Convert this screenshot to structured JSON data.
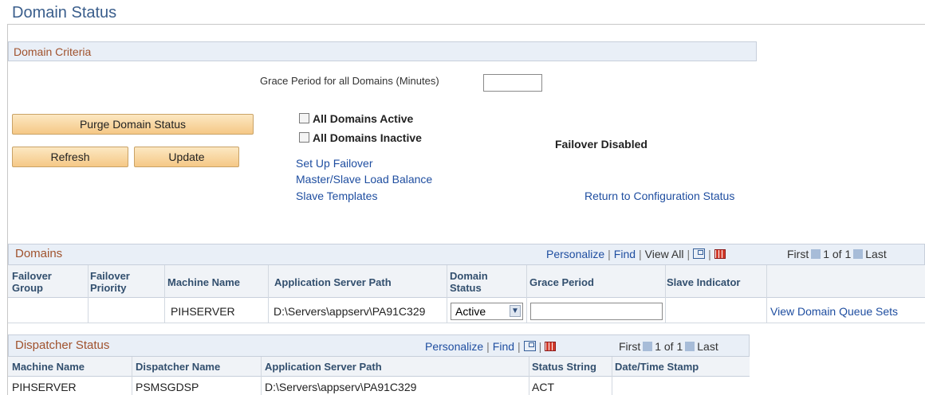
{
  "page": {
    "title": "Domain Status"
  },
  "criteria": {
    "section_title": "Domain Criteria",
    "grace_label": "Grace Period for all Domains (Minutes)",
    "grace_value": "",
    "purge_button": "Purge Domain Status",
    "refresh_button": "Refresh",
    "update_button": "Update",
    "all_active_label": "All Domains Active",
    "all_inactive_label": "All Domains Inactive",
    "failover_status": "Failover Disabled",
    "links": {
      "setup_failover": "Set Up Failover",
      "load_balance": "Master/Slave Load Balance",
      "slave_templates": "Slave Templates",
      "return_config": "Return to Configuration Status"
    }
  },
  "domains": {
    "title": "Domains",
    "nav": {
      "personalize": "Personalize",
      "find": "Find",
      "view_all": "View All",
      "first": "First",
      "range": "1 of 1",
      "last": "Last"
    },
    "columns": {
      "failover_group": "Failover Group",
      "failover_priority": "Failover Priority",
      "machine_name": "Machine Name",
      "app_server_path": "Application Server Path",
      "domain_status": "Domain Status",
      "grace_period": "Grace Period",
      "slave_indicator": "Slave Indicator"
    },
    "row": {
      "failover_group": "",
      "failover_priority": "",
      "machine_name": "PIHSERVER",
      "app_server_path": "D:\\Servers\\appserv\\PA91C329",
      "domain_status": "Active",
      "grace_period": "",
      "slave_indicator": "",
      "queue_link": "View Domain Queue Sets"
    }
  },
  "dispatcher": {
    "title": "Dispatcher Status",
    "nav": {
      "personalize": "Personalize",
      "find": "Find",
      "first": "First",
      "range": "1 of 1",
      "last": "Last"
    },
    "columns": {
      "machine_name": "Machine Name",
      "dispatcher_name": "Dispatcher Name",
      "app_server_path": "Application Server Path",
      "status_string": "Status String",
      "datetime": "Date/Time Stamp"
    },
    "row": {
      "machine_name": "PIHSERVER",
      "dispatcher_name": "PSMSGDSP",
      "app_server_path": "D:\\Servers\\appserv\\PA91C329",
      "status_string": "ACT",
      "datetime": ""
    }
  }
}
